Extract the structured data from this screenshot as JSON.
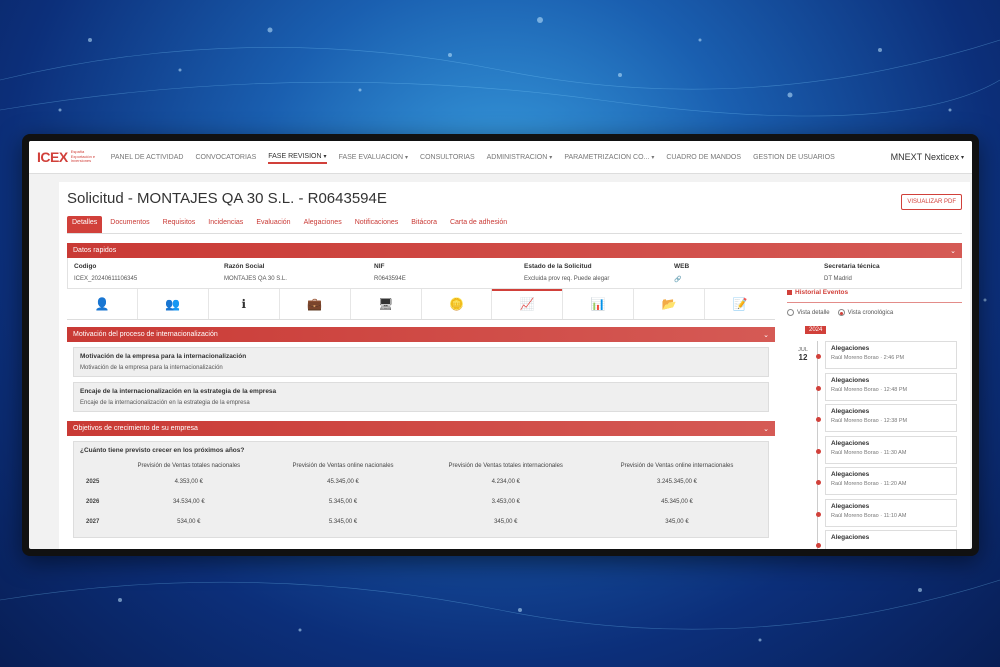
{
  "nav": {
    "logo": "ICEX",
    "logo_sub": "España Exportación e Inversiones",
    "items": [
      {
        "label": "PANEL DE ACTIVIDAD",
        "dropdown": false,
        "active": false
      },
      {
        "label": "CONVOCATORIAS",
        "dropdown": false,
        "active": false
      },
      {
        "label": "FASE REVISION",
        "dropdown": true,
        "active": true
      },
      {
        "label": "FASE EVALUACION",
        "dropdown": true,
        "active": false
      },
      {
        "label": "CONSULTORIAS",
        "dropdown": false,
        "active": false
      },
      {
        "label": "ADMINISTRACION",
        "dropdown": true,
        "active": false
      },
      {
        "label": "PARAMETRIZACION CO...",
        "dropdown": true,
        "active": false
      },
      {
        "label": "CUADRO DE MANDOS",
        "dropdown": false,
        "active": false
      },
      {
        "label": "GESTION DE USUARIOS",
        "dropdown": false,
        "active": false
      }
    ],
    "user": "MNEXT Nexticex"
  },
  "page": {
    "title": "Solicitud - MONTAJES QA 30 S.L. - R0643594E",
    "pdf_button": "VISUALIZAR PDF",
    "tabs": [
      "Detalles",
      "Documentos",
      "Requisitos",
      "Incidencias",
      "Evaluación",
      "Alegaciones",
      "Notificaciones",
      "Bitácora",
      "Carta de adhesión"
    ]
  },
  "quick": {
    "title": "Datos rapidos",
    "fields": [
      {
        "label": "Codigo",
        "value": "ICEX_20240611106345"
      },
      {
        "label": "Razón Social",
        "value": "MONTAJES QA 30 S.L."
      },
      {
        "label": "NIF",
        "value": "R0643594E"
      },
      {
        "label": "Estado de la Solicitud",
        "value": "Excluida prov req. Puede alegar"
      },
      {
        "label": "WEB",
        "value": "🔗"
      },
      {
        "label": "Secretaria técnica",
        "value": "DT Madrid"
      }
    ]
  },
  "iconbar": [
    "user-icon",
    "group-icon",
    "info-icon",
    "briefcase-icon",
    "monitor-icon",
    "coins-icon",
    "trend-chart-icon",
    "bar-chart-icon",
    "folder-icon",
    "edit-doc-icon"
  ],
  "motivacion": {
    "title": "Motivación del proceso de internacionalización",
    "cards": [
      {
        "heading": "Motivación de la empresa para la internacionalización",
        "text": "Motivación de la empresa para la internacionalización"
      },
      {
        "heading": "Encaje de la internacionalización en la estrategia de la empresa",
        "text": "Encaje de la internacionalización en la estrategia de la empresa"
      }
    ]
  },
  "objetivos": {
    "title": "Objetivos de crecimiento de su empresa",
    "question": "¿Cuánto tiene previsto crecer en los próximos años?",
    "headers": [
      "",
      "Previsión de Ventas totales nacionales",
      "Previsión de Ventas online nacionales",
      "Previsión de Ventas totales internacionales",
      "Previsión de Ventas online internacionales"
    ],
    "rows": [
      [
        "2025",
        "4.353,00 €",
        "45.345,00 €",
        "4.234,00 €",
        "3.245.345,00 €"
      ],
      [
        "2026",
        "34.534,00 €",
        "5.345,00 €",
        "3.453,00 €",
        "45.345,00 €"
      ],
      [
        "2027",
        "534,00 €",
        "5.345,00 €",
        "345,00 €",
        "345,00 €"
      ]
    ]
  },
  "historial": {
    "title": "Historial Eventos",
    "radio_detail": "Vista detalle",
    "radio_chrono": "Vista cronológica",
    "year": "2024",
    "month": "JUL",
    "day": "12",
    "events": [
      {
        "title": "Alegaciones",
        "sub": "Raúl Moreno Borao · 2:46 PM"
      },
      {
        "title": "Alegaciones",
        "sub": "Raúl Moreno Borao · 12:48 PM"
      },
      {
        "title": "Alegaciones",
        "sub": "Raúl Moreno Borao · 12:38 PM"
      },
      {
        "title": "Alegaciones",
        "sub": "Raúl Moreno Borao · 11:30 AM"
      },
      {
        "title": "Alegaciones",
        "sub": "Raúl Moreno Borao · 11:20 AM"
      },
      {
        "title": "Alegaciones",
        "sub": "Raúl Moreno Borao · 11:10 AM"
      },
      {
        "title": "Alegaciones",
        "sub": ""
      }
    ]
  }
}
